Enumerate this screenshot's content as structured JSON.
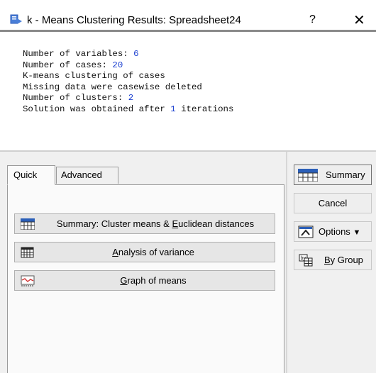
{
  "window": {
    "title": "k - Means Clustering Results: Spreadsheet24",
    "help_label": "?",
    "close_label": "✕"
  },
  "results": {
    "lines": [
      {
        "text": "Number of variables: ",
        "value": "6"
      },
      {
        "text": "Number of cases: ",
        "value": "20"
      },
      {
        "text": "K-means clustering of cases",
        "value": ""
      },
      {
        "text": "Missing data were casewise deleted",
        "value": ""
      },
      {
        "text": "Number of clusters: ",
        "value": "2"
      },
      {
        "text": "Solution was obtained after ",
        "value": "1",
        "suffix": " iterations"
      }
    ]
  },
  "tabs": {
    "quick": "Quick",
    "advanced": "Advanced"
  },
  "buttons": {
    "summary_means": {
      "pre": "Summary: Cluster means & ",
      "u": "E",
      "post": "uclidean distances"
    },
    "anova": {
      "pre": "",
      "u": "A",
      "post": "nalysis of variance"
    },
    "graph": {
      "pre": "",
      "u": "G",
      "post": "raph of means"
    }
  },
  "side": {
    "summary": "Summary",
    "cancel": "Cancel",
    "options": "Options",
    "options_arrow": "▼",
    "bygroup": {
      "u": "B",
      "post": "y Group"
    }
  },
  "colors": {
    "number_blue": "#1a3fd0",
    "panel_gray": "#f0f0f0"
  }
}
